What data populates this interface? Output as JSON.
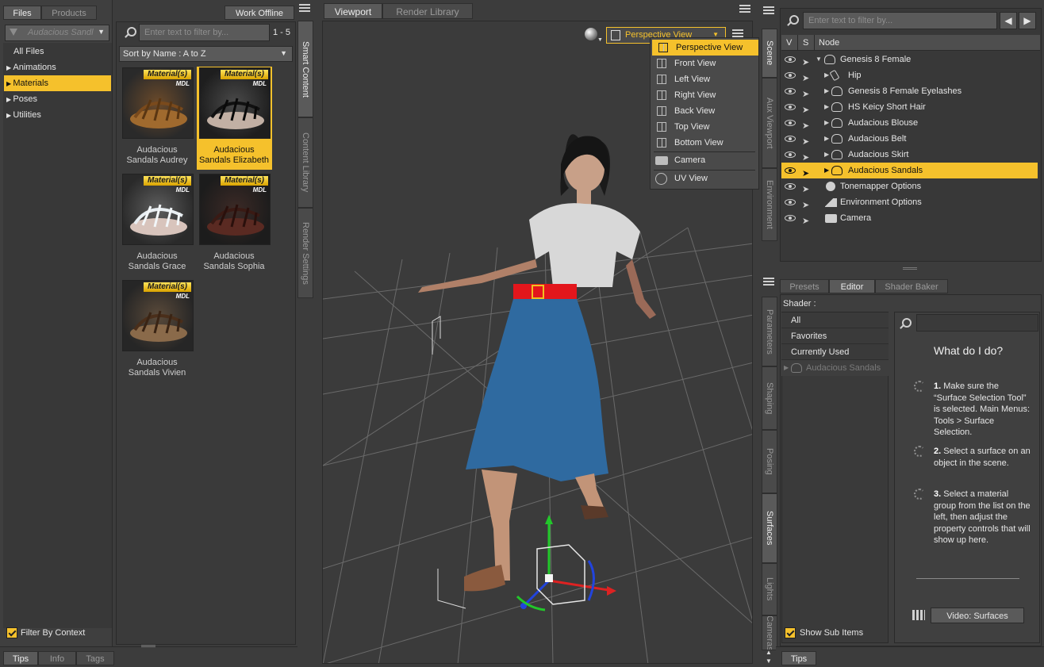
{
  "left_panel": {
    "tabs": [
      "Files",
      "Products"
    ],
    "work_offline": "Work Offline",
    "filter_label": "Audacious Sandl",
    "tree": [
      "All Files",
      "Animations",
      "Materials",
      "Poses",
      "Utilities"
    ],
    "filter_by_context": "Filter By Context",
    "bottom_tabs": [
      "Tips",
      "Info",
      "Tags"
    ]
  },
  "content": {
    "search_placeholder": "Enter text to filter by...",
    "count": "1 - 5",
    "sort": "Sort by Name : A to Z",
    "badge": "Material(s)",
    "mdl": "MDL",
    "items": [
      {
        "line1": "Audacious",
        "line2": "Sandals Audrey"
      },
      {
        "line1": "Audacious",
        "line2": "Sandals Elizabeth"
      },
      {
        "line1": "Audacious",
        "line2": "Sandals Grace"
      },
      {
        "line1": "Audacious",
        "line2": "Sandals Sophia"
      },
      {
        "line1": "Audacious",
        "line2": "Sandals Vivien"
      }
    ]
  },
  "side_tabs_left": [
    "Smart Content",
    "Content Library",
    "Render Settings"
  ],
  "viewport": {
    "tabs": [
      "Viewport",
      "Render Library"
    ],
    "view_label": "Perspective View",
    "menu": [
      "Perspective View",
      "Front View",
      "Left View",
      "Right View",
      "Back View",
      "Top View",
      "Bottom View",
      "Camera",
      "UV View"
    ]
  },
  "side_tabs_right_top": [
    "Scene",
    "Aux Viewport",
    "Environment"
  ],
  "side_tabs_right_bottom": [
    "Parameters",
    "Shaping",
    "Posing",
    "Surfaces",
    "Lights",
    "Cameras"
  ],
  "scene": {
    "search_placeholder": "Enter text to filter by...",
    "headers": [
      "V",
      "S",
      "Node"
    ],
    "nodes": [
      "Genesis 8 Female",
      "Hip",
      "Genesis 8 Female Eyelashes",
      "HS Keicy Short Hair",
      "Audacious Blouse",
      "Audacious Belt",
      "Audacious Skirt",
      "Audacious Sandals",
      "Tonemapper Options",
      "Environment Options",
      "Camera"
    ]
  },
  "surfaces": {
    "tabs": [
      "Presets",
      "Editor",
      "Shader Baker"
    ],
    "shader_label": "Shader :",
    "list": [
      "All",
      "Favorites",
      "Currently Used",
      "Audacious Sandals"
    ],
    "help_title": "What do I do?",
    "step1": "Make sure the “Surface Selection Tool” is selected. Main Menus: Tools > Surface Selection.",
    "step2": "Select a surface on an object in the scene.",
    "step3": "Select a material group from the list on the left, then adjust the property controls that will show up here.",
    "video_button": "Video: Surfaces",
    "show_sub_items": "Show Sub Items",
    "bottom_tab": "Tips"
  }
}
